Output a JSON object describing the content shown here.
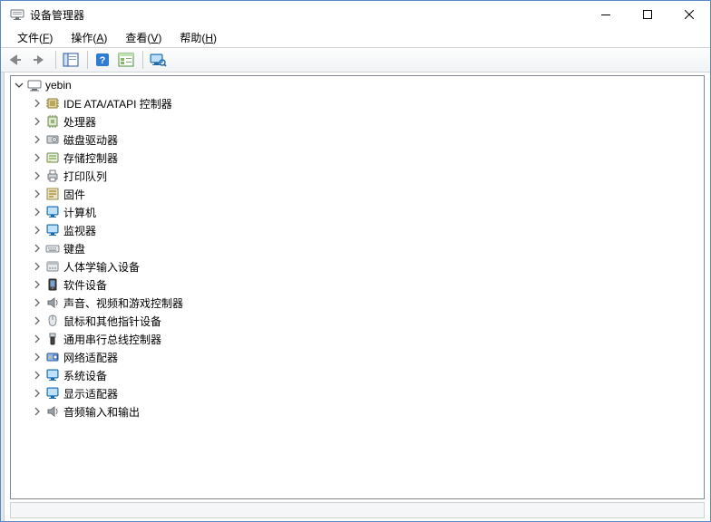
{
  "window": {
    "title": "设备管理器"
  },
  "menu": {
    "file": {
      "label": "文件(",
      "accel": "F",
      "tail": ")"
    },
    "action": {
      "label": "操作(",
      "accel": "A",
      "tail": ")"
    },
    "view": {
      "label": "查看(",
      "accel": "V",
      "tail": ")"
    },
    "help": {
      "label": "帮助(",
      "accel": "H",
      "tail": ")"
    }
  },
  "root": {
    "name": "yebin"
  },
  "categories": [
    {
      "id": "ide",
      "label": "IDE ATA/ATAPI 控制器",
      "icon": "chip"
    },
    {
      "id": "cpu",
      "label": "处理器",
      "icon": "cpu"
    },
    {
      "id": "disk",
      "label": "磁盘驱动器",
      "icon": "disk"
    },
    {
      "id": "storage",
      "label": "存储控制器",
      "icon": "storage"
    },
    {
      "id": "printqueue",
      "label": "打印队列",
      "icon": "printer"
    },
    {
      "id": "firmware",
      "label": "固件",
      "icon": "firmware"
    },
    {
      "id": "computer",
      "label": "计算机",
      "icon": "monitor"
    },
    {
      "id": "monitor",
      "label": "监视器",
      "icon": "monitor"
    },
    {
      "id": "keyboard",
      "label": "键盘",
      "icon": "keyboard"
    },
    {
      "id": "hid",
      "label": "人体学输入设备",
      "icon": "hid"
    },
    {
      "id": "software",
      "label": "软件设备",
      "icon": "software"
    },
    {
      "id": "audio",
      "label": "声音、视频和游戏控制器",
      "icon": "speaker"
    },
    {
      "id": "mouse",
      "label": "鼠标和其他指针设备",
      "icon": "mouse"
    },
    {
      "id": "usb",
      "label": "通用串行总线控制器",
      "icon": "usb"
    },
    {
      "id": "network",
      "label": "网络适配器",
      "icon": "nic"
    },
    {
      "id": "system",
      "label": "系统设备",
      "icon": "system"
    },
    {
      "id": "display",
      "label": "显示适配器",
      "icon": "display"
    },
    {
      "id": "audioio",
      "label": "音频输入和输出",
      "icon": "speaker"
    }
  ]
}
